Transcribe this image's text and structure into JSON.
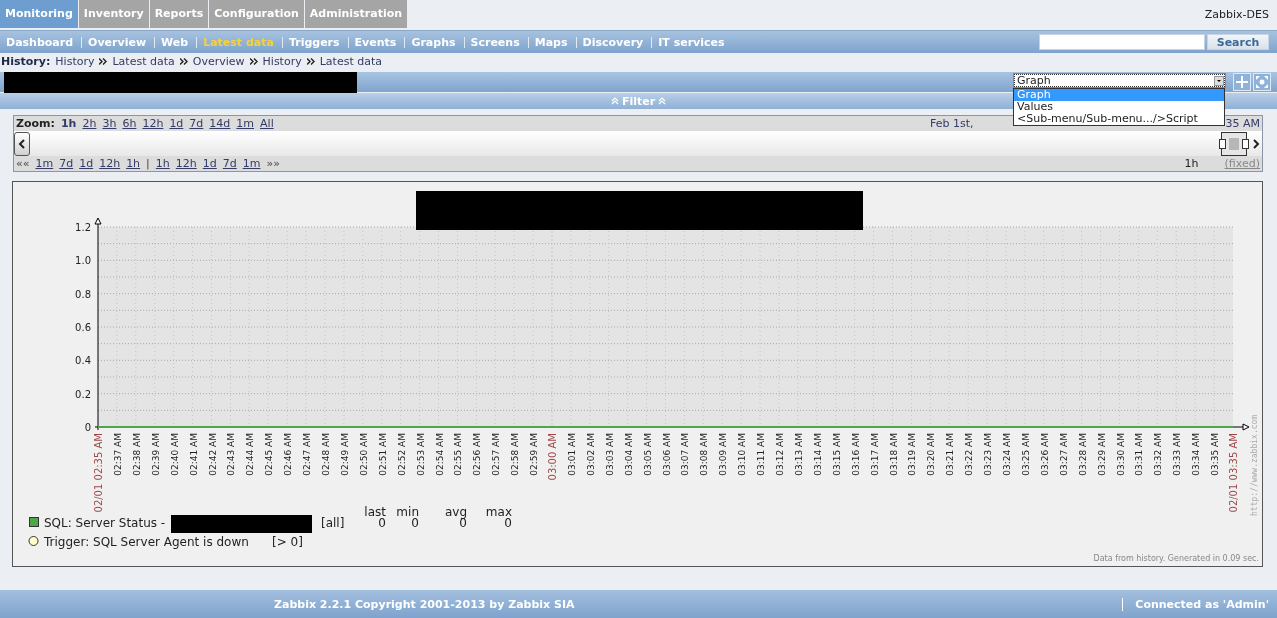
{
  "top_menu": {
    "tabs": [
      {
        "label": "Monitoring",
        "selected": true
      },
      {
        "label": "Inventory",
        "selected": false
      },
      {
        "label": "Reports",
        "selected": false
      },
      {
        "label": "Configuration",
        "selected": false
      },
      {
        "label": "Administration",
        "selected": false
      }
    ],
    "server_name": "Zabbix-DES"
  },
  "sub_menu": {
    "items": [
      {
        "label": "Dashboard",
        "selected": false
      },
      {
        "label": "Overview",
        "selected": false
      },
      {
        "label": "Web",
        "selected": false
      },
      {
        "label": "Latest data",
        "selected": true
      },
      {
        "label": "Triggers",
        "selected": false
      },
      {
        "label": "Events",
        "selected": false
      },
      {
        "label": "Graphs",
        "selected": false
      },
      {
        "label": "Screens",
        "selected": false
      },
      {
        "label": "Maps",
        "selected": false
      },
      {
        "label": "Discovery",
        "selected": false
      },
      {
        "label": "IT services",
        "selected": false
      }
    ],
    "search_button": "Search"
  },
  "history": {
    "label": "History:",
    "items": [
      "History",
      "Latest data",
      "Overview",
      "History",
      "Latest data"
    ]
  },
  "view_select": {
    "value": "Graph",
    "expanded": true,
    "options": [
      {
        "label": "Graph",
        "selected": true
      },
      {
        "label": "Values",
        "selected": false
      },
      {
        "label": "<Sub-menu/Sub-menu.../>Script",
        "selected": false
      }
    ]
  },
  "filter": {
    "label": "Filter"
  },
  "zoom": {
    "label": "Zoom:",
    "periods": [
      {
        "label": "1h",
        "selected": true
      },
      {
        "label": "2h",
        "selected": false
      },
      {
        "label": "3h",
        "selected": false
      },
      {
        "label": "6h",
        "selected": false
      },
      {
        "label": "12h",
        "selected": false
      },
      {
        "label": "1d",
        "selected": false
      },
      {
        "label": "7d",
        "selected": false
      },
      {
        "label": "14d",
        "selected": false
      },
      {
        "label": "1m",
        "selected": false
      },
      {
        "label": "All",
        "selected": false
      }
    ],
    "date_start": "Feb 1st,",
    "date_end": "35 AM",
    "back_mark": "««",
    "back_steps": [
      "1m",
      "7d",
      "1d",
      "12h",
      "1h"
    ],
    "divider": "|",
    "forward_steps": [
      "1h",
      "12h",
      "1d",
      "7d",
      "1m"
    ],
    "forward_mark": "»»",
    "period": "1h",
    "fixed": "(fixed)"
  },
  "graph": {
    "chart_data": {
      "type": "line",
      "ylim": [
        0,
        1.2
      ],
      "yticks": [
        {
          "value": 0,
          "label": "0"
        },
        {
          "value": 0.2,
          "label": "0.2"
        },
        {
          "value": 0.4,
          "label": "0.4"
        },
        {
          "value": 0.6,
          "label": "0.6"
        },
        {
          "value": 0.8,
          "label": "0.8"
        },
        {
          "value": 1,
          "label": "1.0"
        },
        {
          "value": 1.2,
          "label": "1.2"
        }
      ],
      "categories": [
        "02/01 02:35 AM",
        "02:37 AM",
        "02:38 AM",
        "02:39 AM",
        "02:40 AM",
        "02:41 AM",
        "02:42 AM",
        "02:43 AM",
        "02:44 AM",
        "02:45 AM",
        "02:46 AM",
        "02:47 AM",
        "02:48 AM",
        "02:49 AM",
        "02:50 AM",
        "02:51 AM",
        "02:52 AM",
        "02:53 AM",
        "02:54 AM",
        "02:55 AM",
        "02:56 AM",
        "02:57 AM",
        "02:58 AM",
        "02:59 AM",
        "03:00 AM",
        "03:01 AM",
        "03:02 AM",
        "03:03 AM",
        "03:04 AM",
        "03:05 AM",
        "03:06 AM",
        "03:07 AM",
        "03:08 AM",
        "03:09 AM",
        "03:10 AM",
        "03:11 AM",
        "03:12 AM",
        "03:13 AM",
        "03:14 AM",
        "03:15 AM",
        "03:16 AM",
        "03:17 AM",
        "03:18 AM",
        "03:19 AM",
        "03:20 AM",
        "03:21 AM",
        "03:22 AM",
        "03:23 AM",
        "03:24 AM",
        "03:25 AM",
        "03:26 AM",
        "03:27 AM",
        "03:28 AM",
        "03:29 AM",
        "03:30 AM",
        "03:31 AM",
        "03:32 AM",
        "03:33 AM",
        "03:34 AM",
        "03:35 AM",
        "02/01 03:35 AM"
      ],
      "grid": true,
      "series": [
        {
          "name": "SQL: Server Status -",
          "color": "#4aa84a",
          "values": [
            0,
            0,
            0,
            0,
            0,
            0,
            0,
            0,
            0,
            0,
            0,
            0,
            0,
            0,
            0,
            0,
            0,
            0,
            0,
            0,
            0,
            0,
            0,
            0,
            0,
            0,
            0,
            0,
            0,
            0,
            0,
            0,
            0,
            0,
            0,
            0,
            0,
            0,
            0,
            0,
            0,
            0,
            0,
            0,
            0,
            0,
            0,
            0,
            0,
            0,
            0,
            0,
            0,
            0,
            0,
            0,
            0,
            0,
            0,
            0,
            0
          ]
        }
      ]
    },
    "tick_highlighted": [
      true,
      false,
      false,
      false,
      false,
      false,
      false,
      false,
      false,
      false,
      false,
      false,
      false,
      false,
      false,
      false,
      false,
      false,
      false,
      false,
      false,
      false,
      false,
      false,
      true,
      false,
      false,
      false,
      false,
      false,
      false,
      false,
      false,
      false,
      false,
      false,
      false,
      false,
      false,
      false,
      false,
      false,
      false,
      false,
      false,
      false,
      false,
      false,
      false,
      false,
      false,
      false,
      false,
      false,
      false,
      false,
      false,
      false,
      false,
      false,
      true
    ],
    "stat_headers": [
      "last",
      "min",
      "avg",
      "max"
    ],
    "legend": [
      {
        "kind": "item",
        "function": "[all]",
        "stats": [
          "0",
          "0",
          "0",
          "0"
        ]
      },
      {
        "kind": "trigger",
        "name": "Trigger: SQL Server Agent is down",
        "condition": "[> 0]",
        "color": "#ffffc8"
      }
    ],
    "side_url": "http://www.zabbix.com",
    "note": "Data from history. Generated in 0.09 sec."
  },
  "footer": {
    "copyright": "Zabbix 2.2.1 Copyright 2001-2013 by Zabbix SIA",
    "user": "Connected as 'Admin'"
  }
}
